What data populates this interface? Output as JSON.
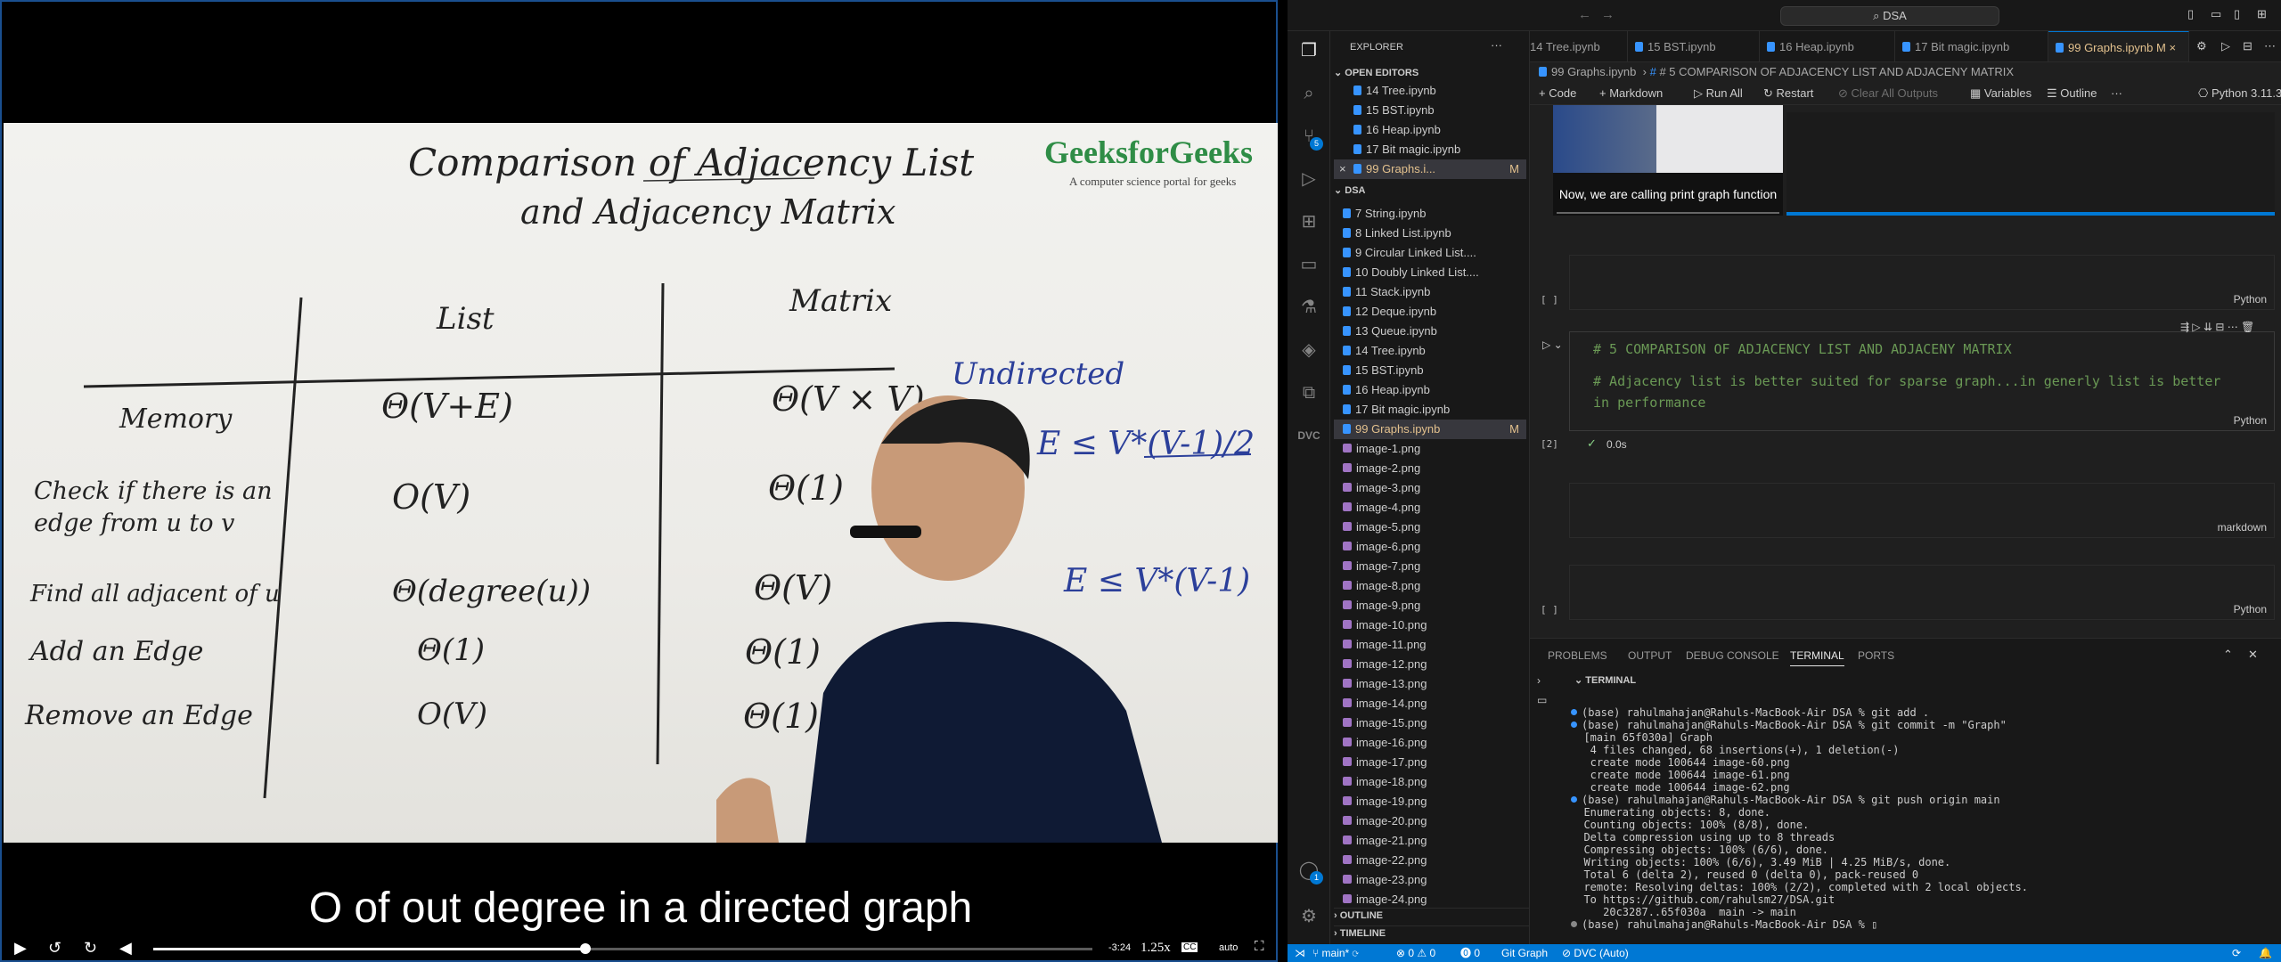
{
  "video": {
    "brand": "GeeksforGeeks",
    "brand_tagline": "A computer science portal for geeks",
    "board": {
      "title_line1": "Comparison of Adjacency List",
      "title_line2": "and Adjacency Matrix",
      "col_list": "List",
      "col_matrix": "Matrix",
      "note_undirected": "Undirected",
      "rows": [
        {
          "label": "Memory",
          "list": "Θ(V+E)",
          "matrix": "Θ(V × V)"
        },
        {
          "label": "Check if there is an edge from u to v",
          "list": "O(V)",
          "matrix": "Θ(1)"
        },
        {
          "label": "Find all adjacent of u",
          "list": "Θ(degree(u))",
          "matrix": "Θ(V)"
        },
        {
          "label": "Add an Edge",
          "list": "Θ(1)",
          "matrix": "Θ(1)"
        },
        {
          "label": "Remove an Edge",
          "list": "O(V)",
          "matrix": "Θ(1)"
        }
      ],
      "right_formula1": "E ≤ V*(V-1)/2",
      "right_formula2": "E ≤ V*(V-1)"
    },
    "subtitle": "O of out degree in a directed graph",
    "controls": {
      "time_remaining": "-3:24",
      "speed": "1.25x",
      "cc": "CC",
      "quality": "auto",
      "progress": 0.46
    }
  },
  "vscode": {
    "search_text": "DSA",
    "explorer_title": "EXPLORER",
    "open_editors_label": "OPEN EDITORS",
    "open_editors": [
      "14 Tree.ipynb",
      "15 BST.ipynb",
      "16 Heap.ipynb",
      "17 Bit magic.ipynb",
      "99 Graphs.i..."
    ],
    "folder_label": "DSA",
    "files": [
      "7 String.ipynb",
      "8 Linked List.ipynb",
      "9 Circular Linked List....",
      "10 Doubly Linked List....",
      "11 Stack.ipynb",
      "12 Deque.ipynb",
      "13 Queue.ipynb",
      "14 Tree.ipynb",
      "15 BST.ipynb",
      "16 Heap.ipynb",
      "17 Bit magic.ipynb",
      "99 Graphs.ipynb"
    ],
    "images": [
      "image-1.png",
      "image-2.png",
      "image-3.png",
      "image-4.png",
      "image-5.png",
      "image-6.png",
      "image-7.png",
      "image-8.png",
      "image-9.png",
      "image-10.png",
      "image-11.png",
      "image-12.png",
      "image-13.png",
      "image-14.png",
      "image-15.png",
      "image-16.png",
      "image-17.png",
      "image-18.png",
      "image-19.png",
      "image-20.png",
      "image-21.png",
      "image-22.png",
      "image-23.png",
      "image-24.png"
    ],
    "outline_label": "OUTLINE",
    "timeline_label": "TIMELINE",
    "modified_marker": "M",
    "tabs": [
      "14 Tree.ipynb",
      "15 BST.ipynb",
      "16 Heap.ipynb",
      "17 Bit magic.ipynb",
      "99 Graphs.ipynb"
    ],
    "breadcrumb": [
      "99 Graphs.ipynb",
      "# 5 COMPARISON OF ADJACENCY LIST AND ADJACENY MATRIX"
    ],
    "toolbar": {
      "code": "Code",
      "markdown": "Markdown",
      "run_all": "Run All",
      "restart": "Restart",
      "clear_outputs": "Clear All Outputs",
      "variables": "Variables",
      "outline": "Outline",
      "kernel": "Python 3.11.3"
    },
    "mini_video_caption": "Now, we are calling print graph function",
    "cells": [
      {
        "bracket": "[ ]",
        "lang": "Python"
      },
      {
        "bracket": "[2]",
        "lang": "Python",
        "line1": "# 5 COMPARISON OF ADJACENCY LIST AND ADJACENY MATRIX",
        "line2": "# Adjacency list is better suited for sparse graph...in generly list is better",
        "line3": "in performance",
        "exec_time": "0.0s"
      },
      {
        "lang": "markdown"
      },
      {
        "bracket": "[ ]",
        "lang": "Python"
      }
    ],
    "panel_tabs": [
      "PROBLEMS",
      "OUTPUT",
      "DEBUG CONSOLE",
      "TERMINAL",
      "PORTS"
    ],
    "terminal_label": "TERMINAL",
    "terminal_lines": [
      "(base) rahulmahajan@Rahuls-MacBook-Air DSA % git add .",
      "(base) rahulmahajan@Rahuls-MacBook-Air DSA % git commit -m \"Graph\"",
      "[main 65f030a] Graph",
      " 4 files changed, 68 insertions(+), 1 deletion(-)",
      " create mode 100644 image-60.png",
      " create mode 100644 image-61.png",
      " create mode 100644 image-62.png",
      "(base) rahulmahajan@Rahuls-MacBook-Air DSA % git push origin main",
      "Enumerating objects: 8, done.",
      "Counting objects: 100% (8/8), done.",
      "Delta compression using up to 8 threads",
      "Compressing objects: 100% (6/6), done.",
      "Writing objects: 100% (6/6), 3.49 MiB | 4.25 MiB/s, done.",
      "Total 6 (delta 2), reused 0 (delta 0), pack-reused 0",
      "remote: Resolving deltas: 100% (2/2), completed with 2 local objects.",
      "To https://github.com/rahulsm27/DSA.git",
      "   20c3287..65f030a  main -> main",
      "(base) rahulmahajan@Rahuls-MacBook-Air DSA % "
    ],
    "status": {
      "branch": "main*",
      "problems": "⊗ 0 ⚠ 0",
      "ports": "⓿ 0",
      "git_graph": "Git Graph",
      "dvc": "DVC (Auto)"
    }
  }
}
